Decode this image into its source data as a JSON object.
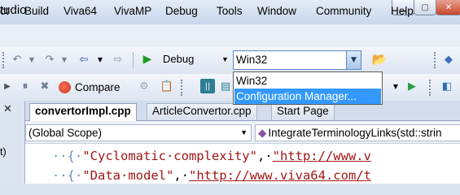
{
  "window": {
    "title": "tudio"
  },
  "menu": [
    "ct",
    "Build",
    "Viva64",
    "VivaMP",
    "Debug",
    "Tools",
    "Window",
    "Community",
    "Help"
  ],
  "toolbar1": {
    "config_value": "Debug",
    "platform_value": "Win32"
  },
  "toolbar2": {
    "compare_label": "Compare"
  },
  "platform_dropdown": {
    "items": [
      "Win32",
      "Configuration Manager..."
    ],
    "selected_index": 1
  },
  "tabs": [
    "convertorImpl.cpp",
    "ArticleConvertor.cpp",
    "Start Page"
  ],
  "active_tab_index": 0,
  "scope": {
    "global_scope": "(Global Scope)",
    "function": "IntegrateTerminologyLinks(std::strin"
  },
  "sidebar": {
    "fragment": "t)"
  },
  "code": [
    {
      "lead": "··{·",
      "str": "\"Cyclomatic·complexity\"",
      "mid": ",·",
      "url": "\"http://www.v"
    },
    {
      "lead": "··{·",
      "str": "\"Data·model\"",
      "mid": ",·",
      "url": "\"http://www.viva64.com/t"
    }
  ],
  "colors": {
    "selection": "#3399ff",
    "string": "#a31515",
    "accent": "#5b86c4"
  }
}
